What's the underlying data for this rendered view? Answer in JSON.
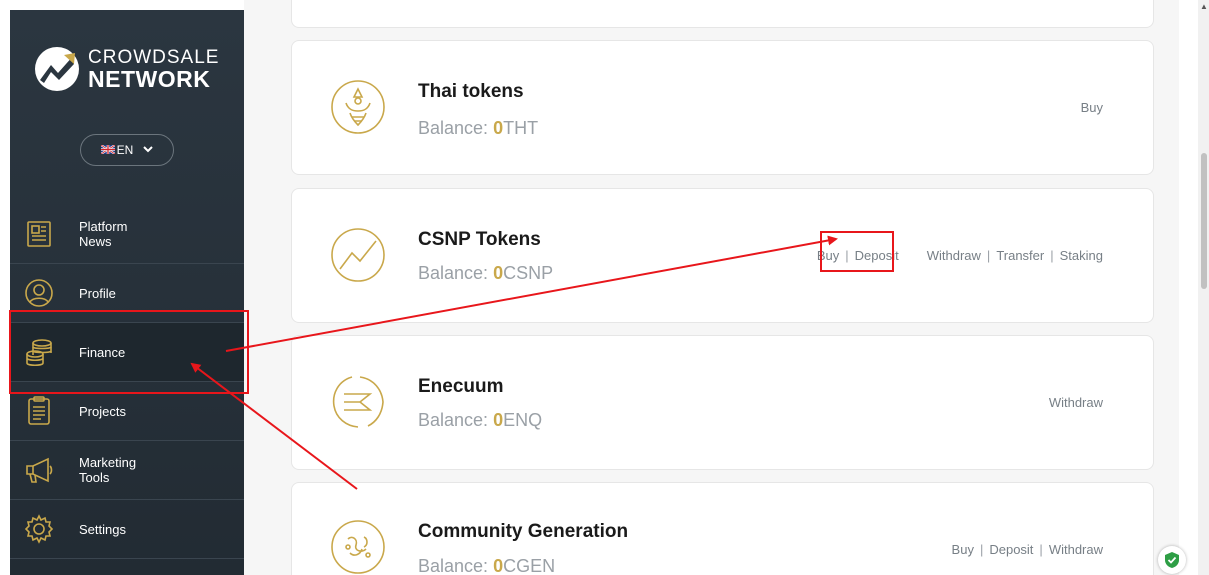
{
  "brand": {
    "line1": "CROWDSALE",
    "line2": "NETWORK"
  },
  "language": {
    "flag": "🇬🇧",
    "code": "EN"
  },
  "sidebar": {
    "items": [
      {
        "label": "Platform News",
        "icon": "newspaper-icon"
      },
      {
        "label": "Profile",
        "icon": "user-icon"
      },
      {
        "label": "Finance",
        "icon": "coins-icon"
      },
      {
        "label": "Projects",
        "icon": "clipboard-icon"
      },
      {
        "label": "Marketing Tools",
        "icon": "megaphone-icon"
      },
      {
        "label": "Settings",
        "icon": "gear-icon"
      }
    ]
  },
  "balance_prefix": "Balance:",
  "tokens": [
    {
      "name": "Thai tokens",
      "balance": "0",
      "symbol": "THT",
      "actions": [
        "Buy"
      ]
    },
    {
      "name": "CSNP Tokens",
      "balance": "0",
      "symbol": "CSNP",
      "actions": [
        "Buy",
        "Deposit",
        "Withdraw",
        "Transfer",
        "Staking"
      ]
    },
    {
      "name": "Enecuum",
      "balance": "0",
      "symbol": "ENQ",
      "actions": [
        "Withdraw"
      ]
    },
    {
      "name": "Community Generation",
      "balance": "0",
      "symbol": "CGEN",
      "actions": [
        "Buy",
        "Deposit",
        "Withdraw"
      ]
    }
  ],
  "colors": {
    "accent_gold": "#c9a84b",
    "sidebar_bg": "#263039",
    "annotation_red": "#e8161b"
  }
}
